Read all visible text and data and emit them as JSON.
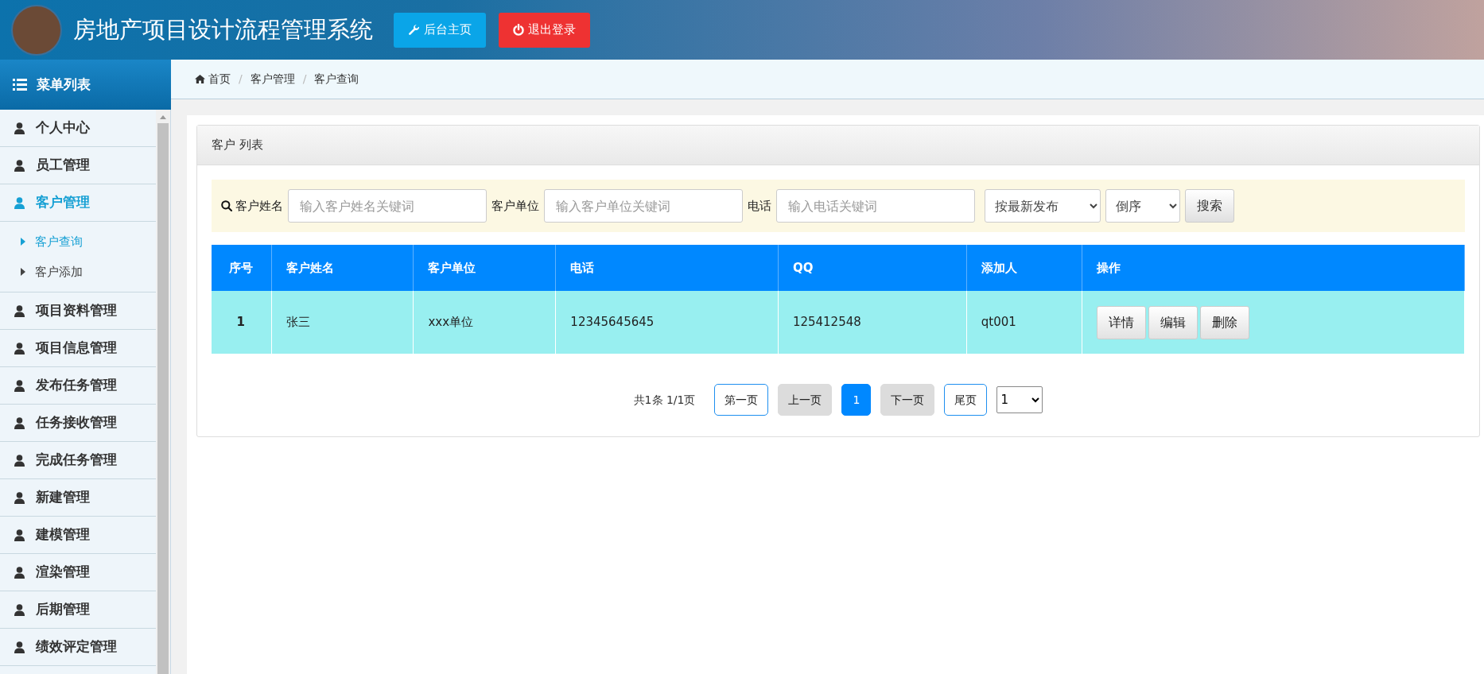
{
  "header": {
    "title": "房地产项目设计流程管理系统",
    "buttons": [
      {
        "label": "后台主页",
        "kind": "home"
      },
      {
        "label": "退出登录",
        "kind": "logout"
      }
    ]
  },
  "sidebar": {
    "title": "菜单列表",
    "items": [
      {
        "label": "个人中心",
        "selected": false
      },
      {
        "label": "员工管理",
        "selected": false
      },
      {
        "label": "客户管理",
        "selected": true,
        "expanded": true,
        "children": [
          {
            "label": "客户查询",
            "selected": true
          },
          {
            "label": "客户添加",
            "selected": false
          }
        ]
      },
      {
        "label": "项目资料管理",
        "selected": false
      },
      {
        "label": "项目信息管理",
        "selected": false
      },
      {
        "label": "发布任务管理",
        "selected": false
      },
      {
        "label": "任务接收管理",
        "selected": false
      },
      {
        "label": "完成任务管理",
        "selected": false
      },
      {
        "label": "新建管理",
        "selected": false
      },
      {
        "label": "建模管理",
        "selected": false
      },
      {
        "label": "渲染管理",
        "selected": false
      },
      {
        "label": "后期管理",
        "selected": false
      },
      {
        "label": "绩效评定管理",
        "selected": false
      }
    ]
  },
  "breadcrumb": {
    "separator": "/",
    "items": [
      "首页",
      "客户管理",
      "客户查询"
    ]
  },
  "panel": {
    "title": "客户 列表",
    "search": {
      "fields": [
        {
          "label": "客户姓名",
          "placeholder": "输入客户姓名关键词"
        },
        {
          "label": "客户单位",
          "placeholder": "输入客户单位关键词"
        },
        {
          "label": "电话",
          "placeholder": "输入电话关键词"
        }
      ],
      "selects": [
        {
          "value": "按最新发布",
          "kind": "wide"
        },
        {
          "value": "倒序",
          "kind": "narrow"
        }
      ],
      "button": "搜索"
    },
    "table": {
      "columns": [
        "序号",
        "客户姓名",
        "客户单位",
        "电话",
        "QQ",
        "添加人",
        "操作"
      ],
      "rows": [
        {
          "cells": [
            "1",
            "张三",
            "xxx单位",
            "12345645645",
            "125412548",
            "qt001"
          ],
          "actions": [
            "详情",
            "编辑",
            "删除"
          ]
        }
      ]
    },
    "pagination": {
      "summary": "共1条 1/1页",
      "buttons": [
        {
          "label": "第一页",
          "kind": "nav",
          "disabled": false
        },
        {
          "label": "上一页",
          "kind": "nav",
          "disabled": true
        },
        {
          "label": "1",
          "kind": "page",
          "selected": true
        },
        {
          "label": "下一页",
          "kind": "nav",
          "disabled": true
        },
        {
          "label": "尾页",
          "kind": "nav",
          "disabled": false
        }
      ],
      "page_select": "1"
    }
  }
}
